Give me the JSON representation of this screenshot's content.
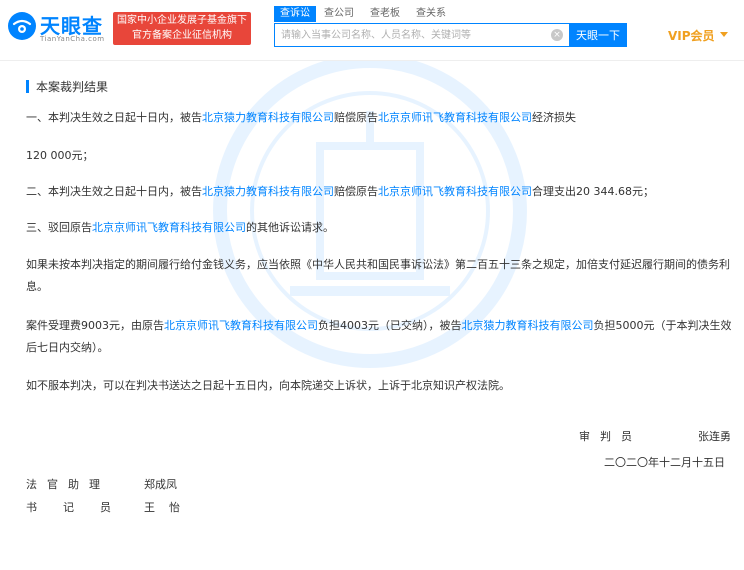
{
  "header": {
    "logo_name": "天眼查",
    "logo_sub": "TianYanCha.com",
    "badge_line1": "国家中小企业发展子基金旗下",
    "badge_line2": "官方备案企业征信机构",
    "tabs": [
      {
        "label": "查诉讼",
        "active": true
      },
      {
        "label": "查公司",
        "active": false
      },
      {
        "label": "查老板",
        "active": false
      },
      {
        "label": "查关系",
        "active": false
      }
    ],
    "search_placeholder": "请输入当事公司名称、人员名称、关键词等",
    "search_button": "天眼一下",
    "vip_label": "VIP会员"
  },
  "content": {
    "section_title": "本案裁判结果",
    "p1": {
      "t1": "一、本判决生效之日起十日内，被告",
      "c1": "北京猿力教育科技有限公司",
      "t2": "赔偿原告",
      "c2": "北京京师讯飞教育科技有限公司",
      "t3": "经济损失"
    },
    "p1_amount": "120 000元；",
    "p2": {
      "t1": "二、本判决生效之日起十日内，被告",
      "c1": "北京猿力教育科技有限公司",
      "t2": "赔偿原告",
      "c2": "北京京师讯飞教育科技有限公司",
      "t3": "合理支出20 344.68元；"
    },
    "p3": {
      "t1": "三、驳回原告",
      "c1": "北京京师讯飞教育科技有限公司",
      "t2": "的其他诉讼请求。"
    },
    "p4": "如果未按本判决指定的期间履行给付金钱义务，应当依照《中华人民共和国民事诉讼法》第二百五十三条之规定，加倍支付延迟履行期间的债务利息。",
    "p5": {
      "t1": "案件受理费9003元，由原告",
      "c1": "北京京师讯飞教育科技有限公司",
      "t2": "负担4003元（已交纳），被告",
      "c2": "北京猿力教育科技有限公司",
      "t3": "负担5000元（于本判决生效后七日内交纳）。"
    },
    "p6": "如不服本判决，可以在判决书送达之日起十五日内，向本院递交上诉状，上诉于北京知识产权法院。",
    "judge_role": "审判员",
    "judge_name": "张连勇",
    "date": "二〇二〇年十二月十五日",
    "assistant_role": "法官助理",
    "assistant_name": "郑成凤",
    "clerk_role": "书记员",
    "clerk_name": "王怡"
  },
  "colors": {
    "brand_blue": "#0084ff",
    "badge_red": "#e8463a",
    "vip_gold": "#f0a020"
  }
}
